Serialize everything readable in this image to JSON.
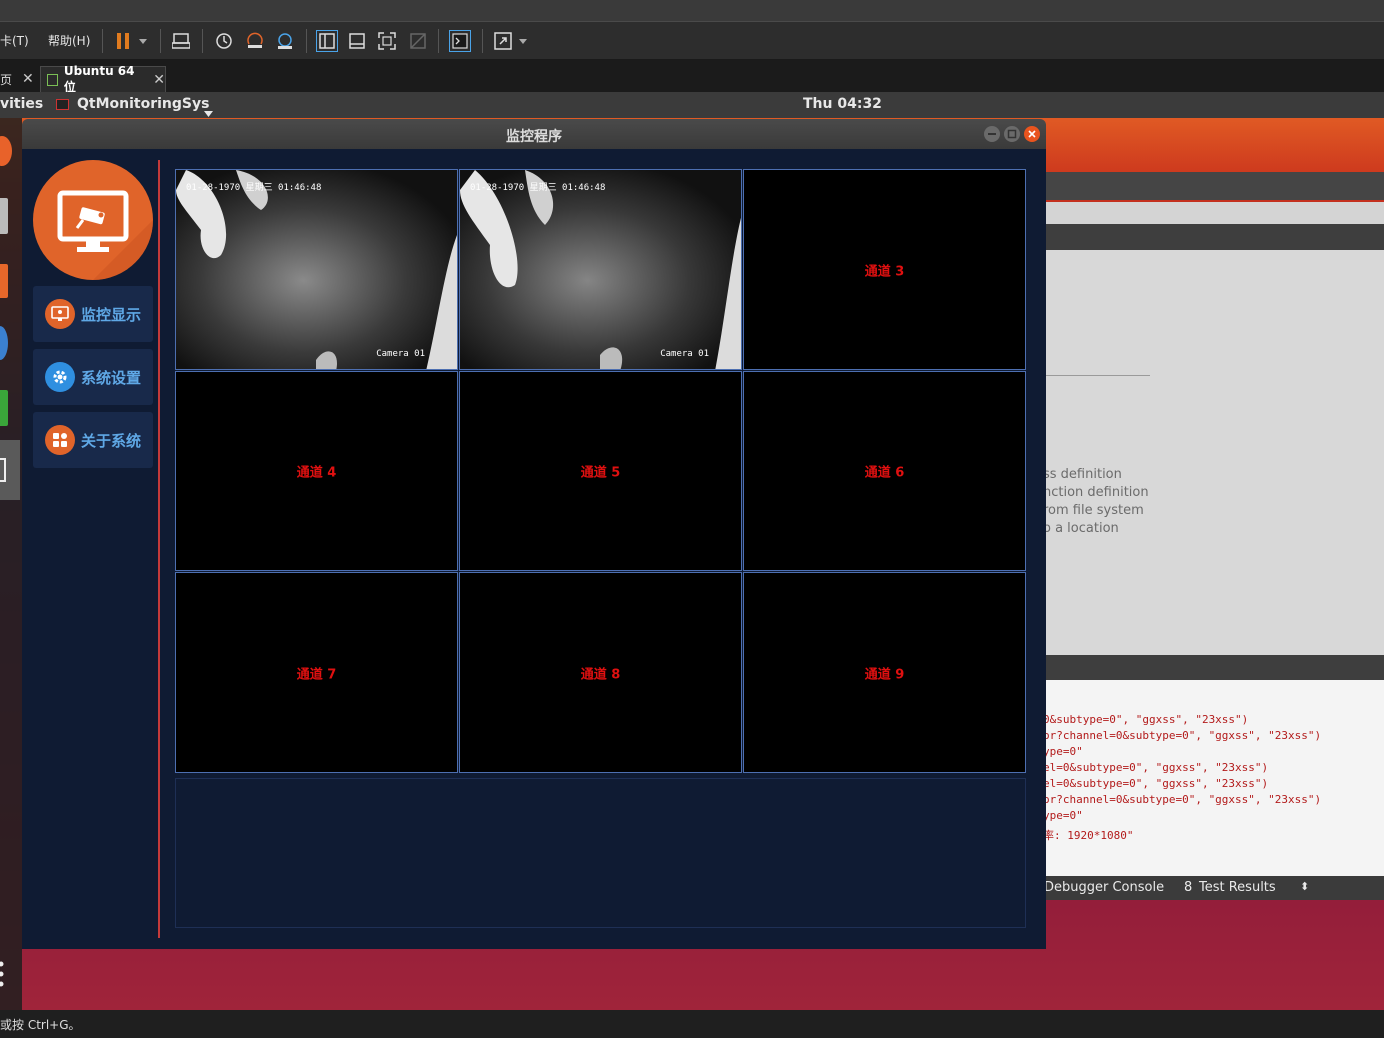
{
  "vm": {
    "menu_tab": "卡(T)",
    "menu_help": "帮助(H)",
    "tab_prev": "页",
    "tab_active": "Ubuntu 64 位",
    "status_text": "或按 Ctrl+G。"
  },
  "ubuntu": {
    "activities": "vities",
    "app_menu": "QtMonitoringSys",
    "clock": "Thu 04:32"
  },
  "ide": {
    "outline_items": [
      "ss definition",
      "nction definition",
      "rom file system",
      "o a location"
    ],
    "console_lines": [
      "0&subtype=0\", \"ggxss\", \"23xss\")",
      "or?channel=0&subtype=0\", \"ggxss\", \"23xss\")",
      "ype=0\"",
      "el=0&subtype=0\", \"ggxss\", \"23xss\")",
      "el=0&subtype=0\", \"ggxss\", \"23xss\")",
      "or?channel=0&subtype=0\", \"ggxss\", \"23xss\")",
      "ype=0\"",
      "率: 1920*1080\""
    ],
    "bottom_tab_debugger": "Debugger Console",
    "bottom_tab_number": "8",
    "bottom_tab_tests": "Test Results"
  },
  "app": {
    "title": "监控程序",
    "nav": [
      {
        "label": "监控显示",
        "icon": "monitor-icon",
        "color": "#e0642a"
      },
      {
        "label": "系统设置",
        "icon": "gear-icon",
        "color": "#2f8fe0"
      },
      {
        "label": "关于系统",
        "icon": "apps-icon",
        "color": "#e0642a"
      }
    ],
    "channels": [
      {
        "label": "",
        "timestamp": "01-28-1970 星期三 01:46:48",
        "camera": "Camera 01"
      },
      {
        "label": "",
        "timestamp": "01-28-1970 星期三 01:46:48",
        "camera": "Camera 01"
      },
      {
        "label": "通道 3"
      },
      {
        "label": "通道 4"
      },
      {
        "label": "通道 5"
      },
      {
        "label": "通道 6"
      },
      {
        "label": "通道 7"
      },
      {
        "label": "通道 8"
      },
      {
        "label": "通道 9"
      }
    ]
  }
}
